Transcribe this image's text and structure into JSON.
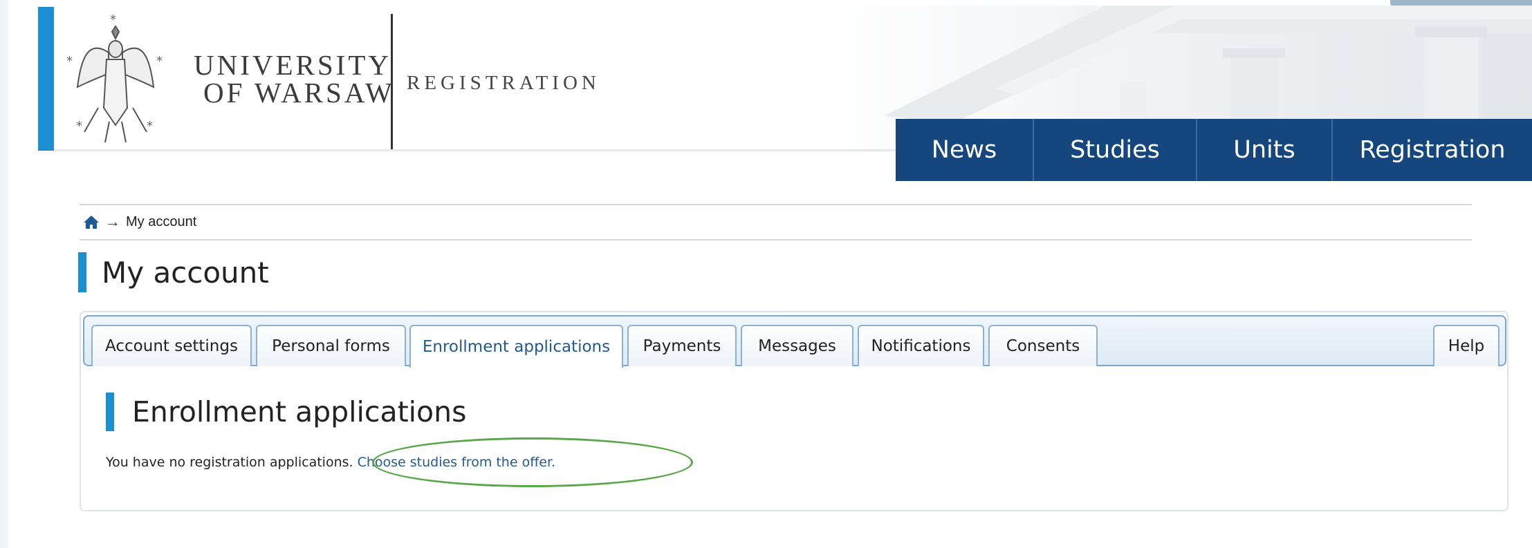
{
  "header": {
    "university_line1": "UNIVERSITY",
    "university_line2": "OF WARSAW",
    "section_label": "REGISTRATION"
  },
  "topnav": {
    "items": [
      {
        "label": "News"
      },
      {
        "label": "Studies"
      },
      {
        "label": "Units"
      },
      {
        "label": "Registration"
      }
    ]
  },
  "breadcrumb": {
    "current": "My account"
  },
  "page": {
    "title": "My account"
  },
  "tabs": [
    {
      "label": "Account settings"
    },
    {
      "label": "Personal forms"
    },
    {
      "label": "Enrollment applications",
      "active": true
    },
    {
      "label": "Payments"
    },
    {
      "label": "Messages"
    },
    {
      "label": "Notifications"
    },
    {
      "label": "Consents"
    },
    {
      "label": "Help"
    }
  ],
  "section": {
    "title": "Enrollment applications",
    "message": "You have no registration applications.",
    "link": "Choose studies from the offer."
  },
  "colors": {
    "accent_blue": "#1c8fd2",
    "nav_blue": "#15467e",
    "link_blue": "#1f5a93",
    "highlight_green": "#5aa64a"
  },
  "icons": {
    "home": "home-icon",
    "arrow": "arrow-right-icon",
    "logo": "eagle-emblem-logo"
  }
}
